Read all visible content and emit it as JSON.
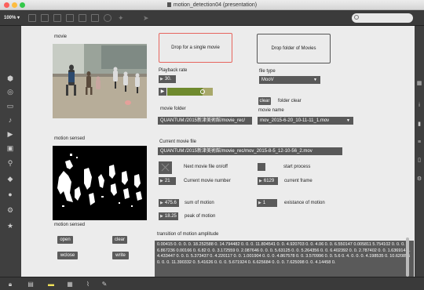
{
  "window": {
    "title": "motion_detection04 (presentation)"
  },
  "toolbar": {
    "zoom": "100%",
    "zoom_arrow": "▾"
  },
  "icons": {
    "toolbar": [
      "lock-icon",
      "grid-icon",
      "new-object-icon",
      "presentation-icon",
      "text-icon",
      "image-icon",
      "help-icon",
      "debug-icon"
    ],
    "sidebar_left": [
      "packages-icon",
      "clippings-icon",
      "objects-icon",
      "audio-icon",
      "video-icon",
      "image-icon",
      "chain-icon",
      "target-icon",
      "info-icon",
      "settings-icon",
      "star-icon"
    ],
    "sidebar_right": [
      "grid-icon",
      "info-icon",
      "inspector-icon",
      "list-icon",
      "bracket-icon",
      "gear-icon"
    ],
    "bottom": [
      "lock-icon",
      "window-icon",
      "chat-icon",
      "grid-icon",
      "wand-icon",
      "hammer-icon"
    ]
  },
  "labels": {
    "movie": "movie",
    "playback_rate": "Playback rate",
    "file_type": "file type",
    "folder_clear": "folder clear",
    "movie_folder": "movie folder",
    "movie_name": "movie name",
    "motion_sensed_top": "motion sensed",
    "current_movie_file": "Current movie file",
    "next_movie": "Next movie file on/off",
    "start_process": "start process",
    "current_movie_number": "Current movie number",
    "current_frame": "current frame",
    "sum_of_motion": "sum of motion",
    "existance_of_motion": "existance of motion",
    "peak_of_motion": "peak of motion",
    "motion_sensed_bottom": "motion sensed",
    "transition": "transition of motion amplitude"
  },
  "dropzones": {
    "single": "Drop for a single movie",
    "folder": "Drop folder of Movies"
  },
  "controls": {
    "playback_rate": "30.",
    "file_type": "MooV",
    "clear": "clear",
    "movie_folder": "QUANTUM:/2015新津美術館/movie_rec/",
    "movie_name": "mov_2015-6-20_10-11-11_1.mov",
    "current_file": "QUANTUM:/2015新津美術館/movie_rec/mov_2015-8-5_12-10-56_2.mov",
    "current_movie_number": "21",
    "current_frame": "6129",
    "sum_of_motion": "475.6",
    "existance_of_motion": "1",
    "peak_of_motion": "18.25",
    "play_glyph": "▶",
    "slider_value": 0.78
  },
  "buttons": {
    "open": "open",
    "clear": "clear",
    "wclose": "wclose",
    "write": "write"
  },
  "transition_text": "0.00415 0. 0. 0. 0. 18.252588 0. 14.794482 0. 0. 0. 11.804541 0. 0. 4.920703 0. 0. 4.06 0. 0. 6.550147 0.005811 5.754102 0. 0. 0. 6.867236 0.00166 0. 6.82 0. 0. 3.172559 0. 2.087646 0. 0. 0. 5.63125 0. 0. 5.264356 0. 0. 6.402392 0. 0. 2.787402 0. 0. 1.636914 0. 4.433447 0. 0. 0. 5.373437 0. 4.220117 0. 0. 1.001904 0. 0. 0. 4.867578 0. 0. 3.570996 0. 0. 5.6 0. 4. 0. 0. 0. 4.198535 0. 10.620855 0. 0. 0. 11.390332 0. 5.41626 0. 0. 0. 5.671924 0. 6.625684 0. 0. 0. 7.625098 0. 0. 4.14458 0."
}
